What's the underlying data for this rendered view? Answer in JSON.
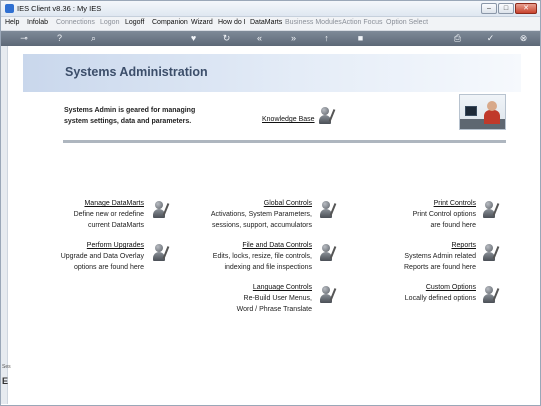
{
  "window": {
    "title": "IES Client v8.36 : My IES"
  },
  "menu": [
    {
      "label": "Help",
      "enabled": true
    },
    {
      "label": "Infolab",
      "enabled": true
    },
    {
      "label": "Connections",
      "enabled": false
    },
    {
      "label": "Logon",
      "enabled": false
    },
    {
      "label": "Logoff",
      "enabled": true
    },
    {
      "label": "Companion",
      "enabled": true
    },
    {
      "label": "Wizard",
      "enabled": true
    },
    {
      "label": "How do I",
      "enabled": true
    },
    {
      "label": "DataMarts",
      "enabled": true
    },
    {
      "label": "Business Modules",
      "enabled": false
    },
    {
      "label": "Action Focus",
      "enabled": false
    },
    {
      "label": "Option Select",
      "enabled": false
    }
  ],
  "toolbar_icons": [
    "key-icon",
    "help-icon",
    "search-icon",
    "favorite-icon",
    "refresh-icon",
    "back-icon",
    "forward-icon",
    "up-icon",
    "stop-icon",
    "print-icon",
    "ok-icon",
    "close-icon"
  ],
  "left_strip": {
    "label": "Ses",
    "glyph": "E"
  },
  "page": {
    "title": "Systems Administration",
    "intro_line1": "Systems Admin is geared for managing",
    "intro_line2": "system settings, data and parameters.",
    "knowledge_base": "Knowledge Base"
  },
  "items": {
    "manage_datamarts": {
      "title": "Manage DataMarts",
      "line1": "Define new or redefine",
      "line2": "current DataMarts"
    },
    "perform_upgrades": {
      "title": "Perform Upgrades",
      "line1": "Upgrade and Data Overlay",
      "line2": "options are found here"
    },
    "global_controls": {
      "title": "Global Controls",
      "line1": "Activations, System Parameters,",
      "line2": "sessions, support, accumulators"
    },
    "file_data_controls": {
      "title": "File and Data Controls",
      "line1": "Edits, locks, resize, file controls,",
      "line2": "indexing and file inspections"
    },
    "language_options": {
      "title": "Language Controls",
      "line1": "Re-Build User Menus,",
      "line2": "Word / Phrase Translate"
    },
    "print_controls": {
      "title": "Print Controls",
      "line1": "Print Control options",
      "line2": "are found here"
    },
    "reports": {
      "title": "Reports",
      "line1": "Systems Admin related",
      "line2": "Reports are found here"
    },
    "custom_options": {
      "title": "Custom Options",
      "line1": "Locally defined options"
    }
  }
}
